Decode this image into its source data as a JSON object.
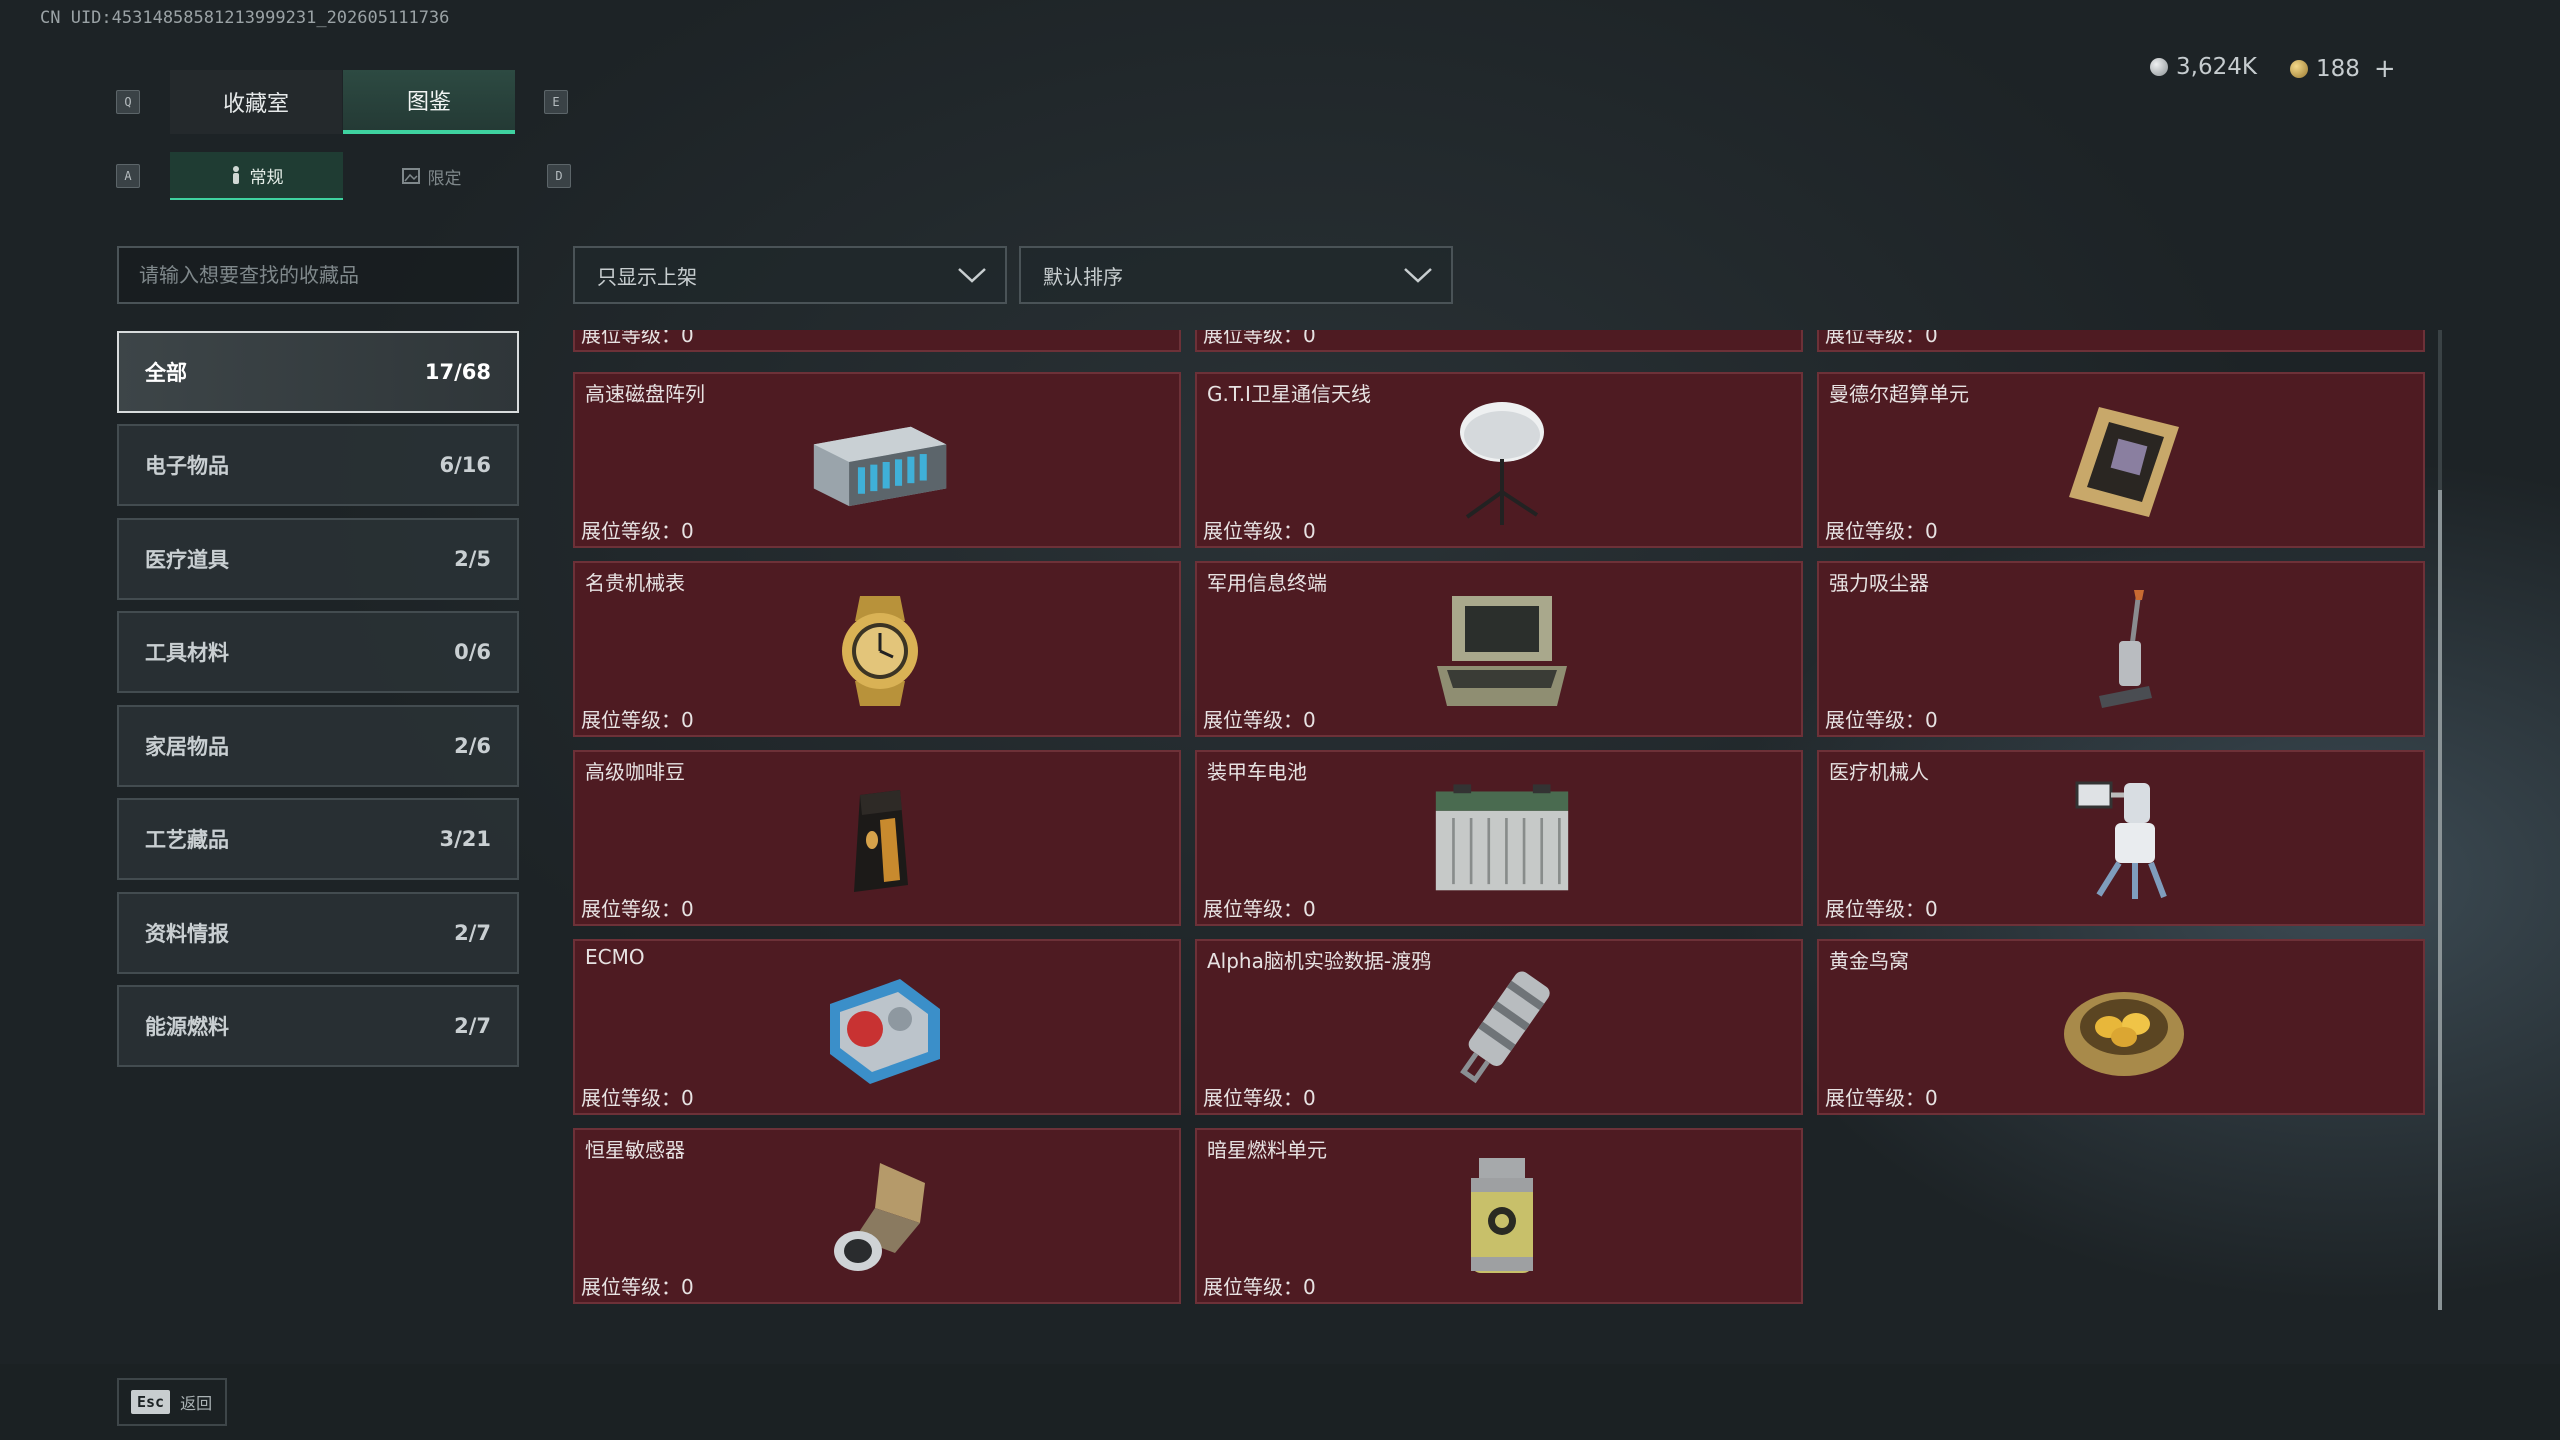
{
  "header": {
    "uid": "CN UID:453148585812139992​31_202605111736",
    "keys": {
      "left_tab": "Q",
      "right_tab": "E",
      "left_sub": "A",
      "right_sub": "D"
    },
    "tabs": [
      {
        "label": "收藏室",
        "active": false
      },
      {
        "label": "图鉴",
        "active": true
      }
    ],
    "subtabs": [
      {
        "label": "常规",
        "icon": "figure-icon",
        "active": true
      },
      {
        "label": "限定",
        "icon": "image-icon",
        "active": false
      }
    ],
    "currency": [
      {
        "value": "3,624K",
        "icon": "silver-coin-icon",
        "color": "#c9ccce"
      },
      {
        "value": "188",
        "icon": "gold-coin-icon",
        "color": "#c9a55a"
      }
    ],
    "add_label": "+"
  },
  "search": {
    "placeholder": "请输入想要查找的收藏品",
    "value": ""
  },
  "filters": {
    "display": "只显示上架",
    "sort": "默认排序"
  },
  "categories": [
    {
      "label": "全部",
      "count": "17/68",
      "active": true
    },
    {
      "label": "电子物品",
      "count": "6/16"
    },
    {
      "label": "医疗道具",
      "count": "2/5"
    },
    {
      "label": "工具材料",
      "count": "0/6"
    },
    {
      "label": "家居物品",
      "count": "2/6"
    },
    {
      "label": "工艺藏品",
      "count": "3/21"
    },
    {
      "label": "资料情报",
      "count": "2/7"
    },
    {
      "label": "能源燃料",
      "count": "2/7"
    }
  ],
  "level_prefix": "展位等级：",
  "items": [
    {
      "name": "",
      "level": "0",
      "icon": ""
    },
    {
      "name": "",
      "level": "0",
      "icon": ""
    },
    {
      "name": "",
      "level": "0",
      "icon": ""
    },
    {
      "name": "高速磁盘阵列",
      "level": "0",
      "icon": "disk-array-icon"
    },
    {
      "name": "G.T.I卫星通信天线",
      "level": "0",
      "icon": "satellite-dish-icon"
    },
    {
      "name": "曼德尔超算单元",
      "level": "0",
      "icon": "compute-unit-icon"
    },
    {
      "name": "名贵机械表",
      "level": "0",
      "icon": "watch-icon"
    },
    {
      "name": "军用信息终端",
      "level": "0",
      "icon": "terminal-icon"
    },
    {
      "name": "强力吸尘器",
      "level": "0",
      "icon": "vacuum-icon"
    },
    {
      "name": "高级咖啡豆",
      "level": "0",
      "icon": "coffee-bag-icon"
    },
    {
      "name": "装甲车电池",
      "level": "0",
      "icon": "battery-icon"
    },
    {
      "name": "医疗机械人",
      "level": "0",
      "icon": "medical-robot-icon"
    },
    {
      "name": "ECMO",
      "level": "0",
      "icon": "ecmo-icon"
    },
    {
      "name": "Alpha脑机实验数据-渡鸦",
      "level": "0",
      "icon": "data-canister-icon"
    },
    {
      "name": "黄金鸟窝",
      "level": "0",
      "icon": "golden-nest-icon"
    },
    {
      "name": "恒星敏感器",
      "level": "0",
      "icon": "star-sensor-icon"
    },
    {
      "name": "暗星燃料单元",
      "level": "0",
      "icon": "fuel-canister-icon"
    }
  ],
  "footer": {
    "esc_key": "Esc",
    "back_label": "返回"
  }
}
